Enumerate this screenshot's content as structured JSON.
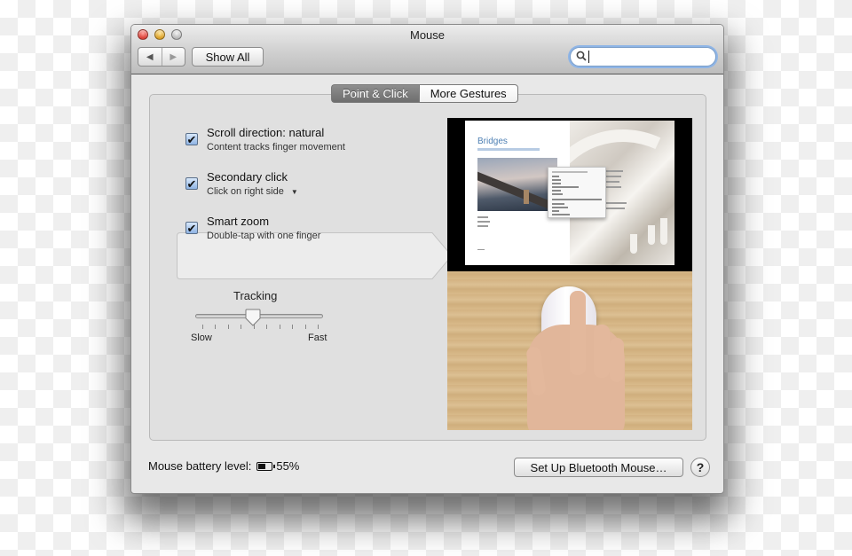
{
  "window": {
    "title": "Mouse",
    "nav_back_icon": "◀",
    "nav_forward_icon": "▶",
    "show_all_label": "Show All",
    "search": {
      "value": "",
      "placeholder": "",
      "icon": "search-icon",
      "icon_glyph": "⚲"
    }
  },
  "tabs": [
    {
      "label": "Point & Click",
      "active": true
    },
    {
      "label": "More Gestures",
      "active": false
    }
  ],
  "options": [
    {
      "label": "Scroll direction: natural",
      "description": "Content tracks finger movement",
      "checked": true,
      "check_glyph": "✔"
    },
    {
      "label": "Secondary click",
      "description": "Click on right side",
      "checked": true,
      "has_dropdown": true,
      "dropdown_glyph": "▼",
      "check_glyph": "✔",
      "highlighted": true
    },
    {
      "label": "Smart zoom",
      "description": "Double-tap with one finger",
      "checked": true,
      "check_glyph": "✔"
    }
  ],
  "tracking": {
    "label": "Tracking",
    "min_label": "Slow",
    "max_label": "Fast",
    "tick_count": 10,
    "value_fraction": 0.44
  },
  "preview": {
    "document_title": "Bridges"
  },
  "footer": {
    "battery_label": "Mouse battery level:",
    "battery_percent": "55%",
    "battery_fraction": 0.55,
    "setup_button": "Set Up Bluetooth Mouse…",
    "help_glyph": "?"
  }
}
